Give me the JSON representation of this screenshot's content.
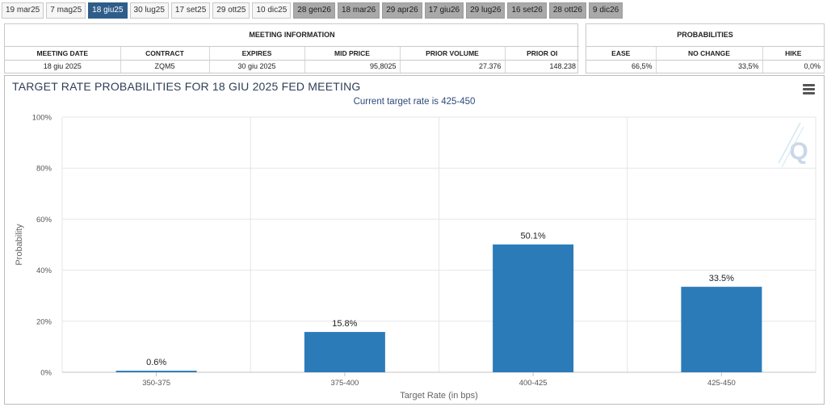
{
  "tabs": [
    {
      "label": "19 mar25",
      "state": "past"
    },
    {
      "label": "7 mag25",
      "state": "past"
    },
    {
      "label": "18 giu25",
      "state": "active"
    },
    {
      "label": "30 lug25",
      "state": "past"
    },
    {
      "label": "17 set25",
      "state": "past"
    },
    {
      "label": "29 ott25",
      "state": "past"
    },
    {
      "label": "10 dic25",
      "state": "past"
    },
    {
      "label": "28 gen26",
      "state": "future"
    },
    {
      "label": "18 mar26",
      "state": "future"
    },
    {
      "label": "29 apr26",
      "state": "future"
    },
    {
      "label": "17 giu26",
      "state": "future"
    },
    {
      "label": "29 lug26",
      "state": "future"
    },
    {
      "label": "16 set26",
      "state": "future"
    },
    {
      "label": "28 ott26",
      "state": "future"
    },
    {
      "label": "9 dic26",
      "state": "future"
    }
  ],
  "meeting_info": {
    "heading": "MEETING INFORMATION",
    "headers": [
      "MEETING DATE",
      "CONTRACT",
      "EXPIRES",
      "MID PRICE",
      "PRIOR VOLUME",
      "PRIOR OI"
    ],
    "row": [
      "18 giu 2025",
      "ZQM5",
      "30 giu 2025",
      "95,8025",
      "27.376",
      "148.238"
    ]
  },
  "probabilities": {
    "heading": "PROBABILITIES",
    "headers": [
      "EASE",
      "NO CHANGE",
      "HIKE"
    ],
    "row": [
      "66,5%",
      "33,5%",
      "0,0%"
    ]
  },
  "colors": {
    "bar": "#2b7bb9",
    "active_tab": "#2f5d8a",
    "title": "#2e3e57"
  },
  "chart_data": {
    "type": "bar",
    "title": "TARGET RATE PROBABILITIES FOR 18 GIU 2025 FED MEETING",
    "subtitle": "Current target rate is 425-450",
    "xlabel": "Target Rate (in bps)",
    "ylabel": "Probability",
    "categories": [
      "350-375",
      "375-400",
      "400-425",
      "425-450"
    ],
    "values": [
      0.6,
      15.8,
      50.1,
      33.5
    ],
    "data_labels": [
      "0.6%",
      "15.8%",
      "50.1%",
      "33.5%"
    ],
    "ylim": [
      0,
      100
    ],
    "yticks": [
      0,
      20,
      40,
      60,
      80,
      100
    ],
    "ytick_labels": [
      "0%",
      "20%",
      "40%",
      "60%",
      "80%",
      "100%"
    ],
    "grid": true,
    "legend": "none"
  }
}
